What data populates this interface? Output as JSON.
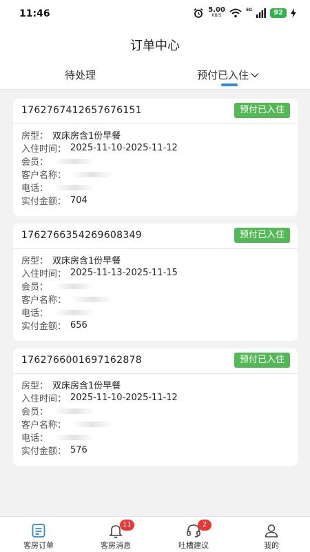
{
  "status_bar": {
    "time": "11:46",
    "net_speed": "5.00",
    "net_unit": "KB/S",
    "network": "5G",
    "battery": "92"
  },
  "header": {
    "title": "订单中心",
    "tabs": [
      {
        "label": "待处理"
      },
      {
        "label": "预付已入住"
      }
    ]
  },
  "labels": {
    "room_type": "房型：",
    "stay_time": "入住时间：",
    "member": "会员：",
    "customer": "客户名称：",
    "phone": "电话：",
    "paid": "实付金额："
  },
  "orders": [
    {
      "order_no": "1762767412657676151",
      "status": "预付已入住",
      "room_type": "双床房含1份早餐",
      "stay_time": "2025-11-10-2025-11-12",
      "paid": "704"
    },
    {
      "order_no": "1762766354269608349",
      "status": "预付已入住",
      "room_type": "双床房含1份早餐",
      "stay_time": "2025-11-13-2025-11-15",
      "paid": "656"
    },
    {
      "order_no": "1762766001697162878",
      "status": "预付已入住",
      "room_type": "双床房含1份早餐",
      "stay_time": "2025-11-10-2025-11-12",
      "paid": "576"
    }
  ],
  "tabbar": {
    "items": [
      {
        "label": "客房订单",
        "icon": "order-list-icon"
      },
      {
        "label": "客房消息",
        "icon": "bell-icon",
        "badge": "11"
      },
      {
        "label": "吐槽建议",
        "icon": "headset-icon",
        "badge": "2"
      },
      {
        "label": "我的",
        "icon": "user-icon"
      }
    ]
  },
  "colors": {
    "accent": "#2f8bd8",
    "status_green": "#55b857",
    "badge_red": "#e53935"
  }
}
